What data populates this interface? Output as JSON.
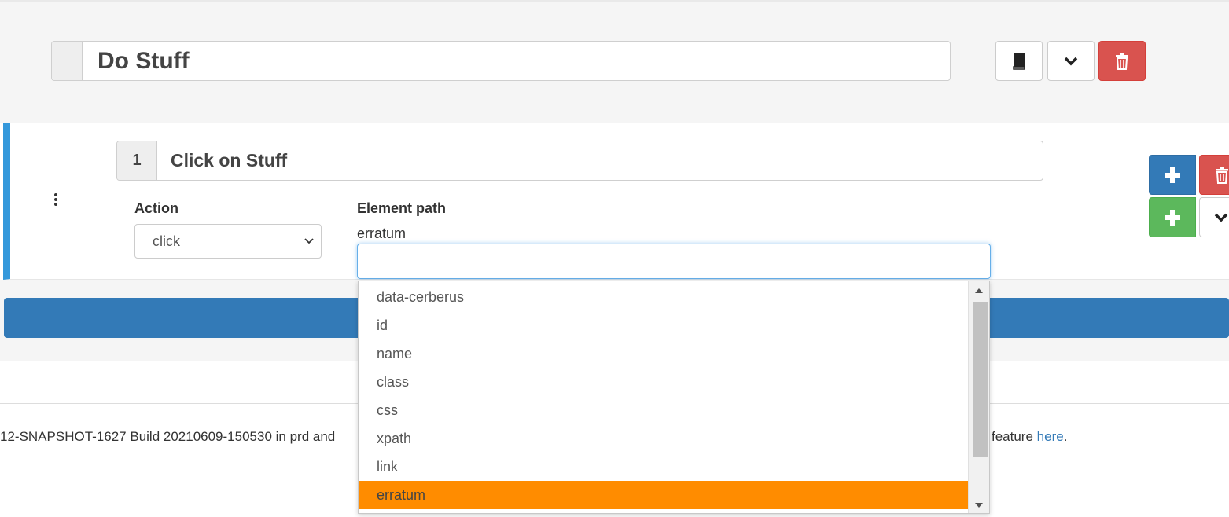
{
  "header": {
    "title": "Do Stuff"
  },
  "step": {
    "number": "1",
    "title": "Click on Stuff",
    "action_label": "Action",
    "action_value": "click",
    "element_path_label": "Element path",
    "element_path_value": "erratum",
    "element_path_input": ""
  },
  "dropdown": {
    "options": [
      "data-cerberus",
      "id",
      "name",
      "class",
      "css",
      "xpath",
      "link",
      "erratum"
    ],
    "selected": "erratum"
  },
  "footer": {
    "left_text": "12-SNAPSHOT-1627 Build 20210609-150530 in prd and",
    "right_text": "w feature ",
    "link_text": "here",
    "period": "."
  },
  "icons": {
    "book": "book-icon",
    "chevron": "chevron-down-icon",
    "trash": "trash-icon",
    "plus": "plus-icon",
    "dots": "vertical-dots-icon"
  },
  "colors": {
    "accent_blue": "#337ab7",
    "danger_red": "#d9534f",
    "success_green": "#5cb85c",
    "step_border": "#3498db",
    "selected_option": "#ff8c00"
  }
}
